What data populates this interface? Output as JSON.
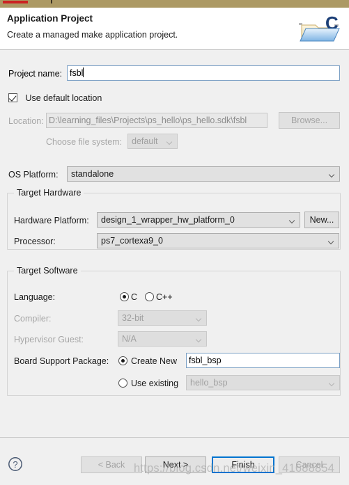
{
  "header": {
    "title": "Application Project",
    "subtitle": "Create a managed make application project.",
    "icon": "c-project-folder-icon"
  },
  "form": {
    "project_name": {
      "label": "Project name:",
      "value": "fsbl"
    },
    "use_default_location": {
      "label": "Use default location",
      "checked": true
    },
    "location": {
      "label": "Location:",
      "value": "D:\\learning_files\\Projects\\ps_hello\\ps_hello.sdk\\fsbl",
      "browse_label": "Browse...",
      "enabled": false
    },
    "file_system": {
      "label": "Choose file system:",
      "value": "default",
      "enabled": false
    },
    "os_platform": {
      "label": "OS Platform:",
      "value": "standalone"
    }
  },
  "target_hardware": {
    "legend": "Target Hardware",
    "hardware_platform": {
      "label": "Hardware Platform:",
      "value": "design_1_wrapper_hw_platform_0",
      "new_label": "New..."
    },
    "processor": {
      "label": "Processor:",
      "value": "ps7_cortexa9_0"
    }
  },
  "target_software": {
    "legend": "Target Software",
    "language": {
      "label": "Language:",
      "options": [
        "C",
        "C++"
      ],
      "selected": "C"
    },
    "compiler": {
      "label": "Compiler:",
      "value": "32-bit",
      "enabled": false
    },
    "hypervisor_guest": {
      "label": "Hypervisor Guest:",
      "value": "N/A",
      "enabled": false
    },
    "board_support_package": {
      "label": "Board Support Package:",
      "create_new_label": "Create New",
      "create_new_value": "fsbl_bsp",
      "use_existing_label": "Use existing",
      "use_existing_value": "hello_bsp",
      "selected": "Create New"
    }
  },
  "footer": {
    "help_icon": "question-mark-help-icon",
    "back_label": "< Back",
    "next_label": "Next >",
    "finish_label": "Finish",
    "cancel_label": "Cancel"
  },
  "watermark": {
    "text": "https://blog.csdn.net/weixin_41688854"
  },
  "colors": {
    "focus_blue": "#0073cf",
    "input_border_blue": "#7a9fc4",
    "title_strip": "#ac9964",
    "background": "#f0f0f0"
  }
}
